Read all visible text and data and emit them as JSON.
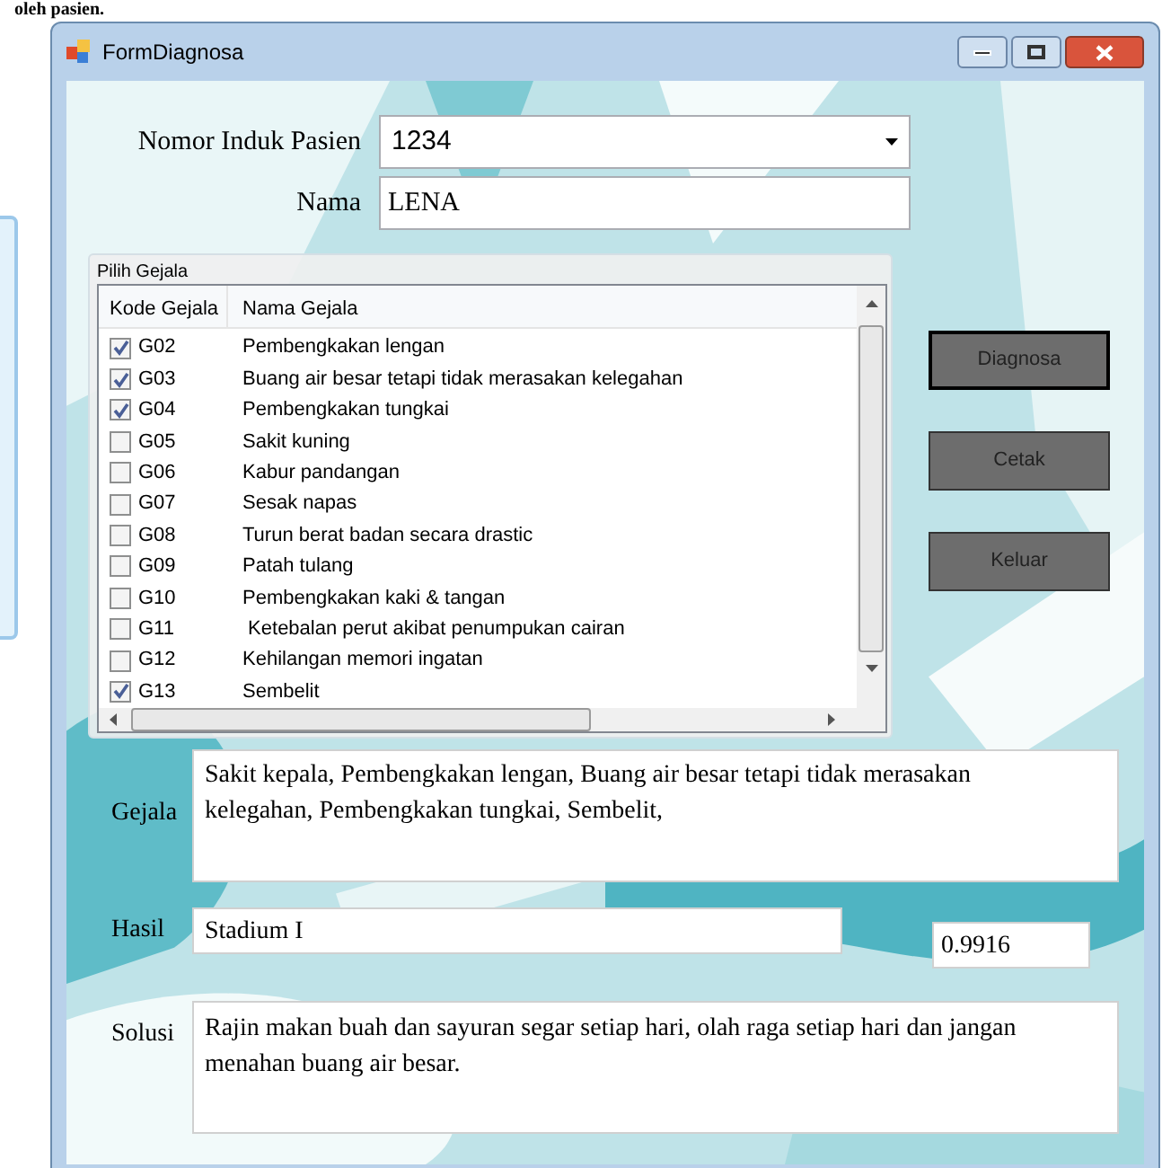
{
  "document_text": "oleh pasien.",
  "window": {
    "title": "FormDiagnosa"
  },
  "patient": {
    "id_label": "Nomor Induk Pasien",
    "id_value": "1234",
    "name_label": "Nama",
    "name_value": "LENA"
  },
  "symptom_group": {
    "title": "Pilih Gejala",
    "columns": [
      "Kode Gejala",
      "Nama Gejala"
    ],
    "rows": [
      {
        "code": "G02",
        "name": "Pembengkakan lengan",
        "checked": true
      },
      {
        "code": "G03",
        "name": "Buang air besar tetapi tidak merasakan kelegahan",
        "checked": true
      },
      {
        "code": "G04",
        "name": "Pembengkakan tungkai",
        "checked": true
      },
      {
        "code": "G05",
        "name": "Sakit kuning",
        "checked": false
      },
      {
        "code": "G06",
        "name": "Kabur pandangan",
        "checked": false
      },
      {
        "code": "G07",
        "name": "Sesak napas",
        "checked": false
      },
      {
        "code": "G08",
        "name": "Turun berat badan secara drastic",
        "checked": false
      },
      {
        "code": "G09",
        "name": "Patah tulang",
        "checked": false
      },
      {
        "code": "G10",
        "name": "Pembengkakan kaki & tangan",
        "checked": false
      },
      {
        "code": "G11",
        "name": " Ketebalan perut akibat penumpukan cairan",
        "checked": false
      },
      {
        "code": "G12",
        "name": "Kehilangan memori ingatan",
        "checked": false
      },
      {
        "code": "G13",
        "name": "Sembelit",
        "checked": true
      }
    ]
  },
  "buttons": [
    {
      "label": "Diagnosa",
      "focused": true
    },
    {
      "label": "Cetak",
      "focused": false
    },
    {
      "label": "Keluar",
      "focused": false
    }
  ],
  "gejala": {
    "label": "Gejala",
    "value": "Sakit kepala, Pembengkakan lengan, Buang air besar tetapi tidak merasakan kelegahan, Pembengkakan tungkai, Sembelit,"
  },
  "hasil": {
    "label": "Hasil",
    "value": "Stadium I",
    "score": "0.9916"
  },
  "solusi": {
    "label": "Solusi",
    "value": "Rajin makan buah dan sayuran segar setiap hari, olah raga setiap hari dan jangan menahan buang air besar."
  }
}
